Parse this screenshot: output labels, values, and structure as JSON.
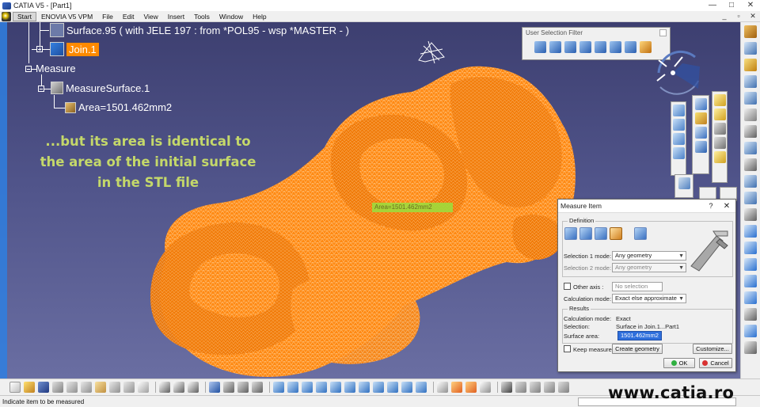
{
  "window": {
    "title": "CATIA V5 - [Part1]",
    "min": "—",
    "max": "□",
    "close": "✕"
  },
  "menu": {
    "items": [
      "Start",
      "ENOVIA V5 VPM",
      "File",
      "Edit",
      "View",
      "Insert",
      "Tools",
      "Window",
      "Help"
    ],
    "doc_controls": [
      "_",
      "▫",
      "✕"
    ]
  },
  "tree": {
    "surface": "Surface.95 ( with JELE 197 : from *POL95 - wsp *MASTER - )",
    "join": "Join.1",
    "measure": "Measure",
    "measure_surface": "MeasureSurface.1",
    "area": "Area=1501.462mm2"
  },
  "caption": {
    "line1": "...but its area is identical to",
    "line2": "the area of the initial surface",
    "line3": "in the STL file"
  },
  "mesh_label": "Area=1501.462mm2",
  "user_selection_filter": {
    "title": "User Selection Filter"
  },
  "measure_dialog": {
    "title": "Measure Item",
    "help": "?",
    "close": "✕",
    "definition_label": "Definition",
    "selection1_label": "Selection 1 mode:",
    "selection1_value": "Any geometry",
    "selection2_label": "Selection 2 mode:",
    "selection2_value": "Any geometry",
    "other_axis_label": "Other axis :",
    "other_axis_value": "No selection",
    "calc_mode_label": "Calculation mode:",
    "calc_mode_value": "Exact else approximate",
    "results_label": "Results",
    "res_calc_label": "Calculation mode:",
    "res_calc_value": "Exact",
    "res_selection_label": "Selection:",
    "res_selection_value": "Surface in Join.1...Part1",
    "res_area_label": "Surface area:",
    "res_area_value": "1501.462mm2",
    "keep_measure": "Keep measure",
    "create_geometry": "Create geometry",
    "customize": "Customize...",
    "ok": "OK",
    "cancel": "Cancel"
  },
  "status": {
    "message": "Indicate item to be measured"
  },
  "watermark": "www.catia.ro",
  "colors": {
    "mesh": "#ff8a14",
    "background_top": "#3d3f70",
    "caption": "#c4d86a",
    "selection": "#2f6fdc"
  }
}
